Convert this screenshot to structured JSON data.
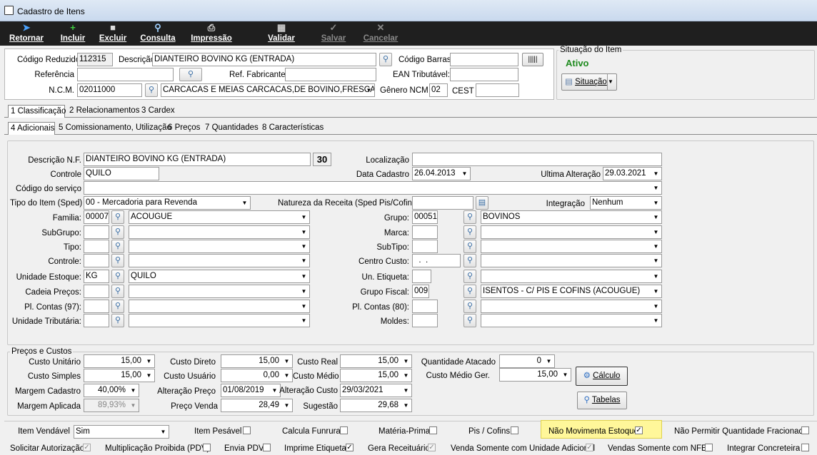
{
  "window": {
    "title": "Cadastro de Itens"
  },
  "toolbar": {
    "retornar": "Retornar",
    "incluir": "Incluir",
    "excluir": "Excluir",
    "consulta": "Consulta",
    "impressao": "Impressão",
    "validar": "Validar",
    "salvar": "Salvar",
    "cancelar": "Cancelar"
  },
  "header": {
    "codigo_reduzido_label": "Código Reduzido",
    "codigo_reduzido": "112315",
    "descricao_label": "Descrição",
    "descricao": "DIANTEIRO  BOVINO KG (ENTRADA)",
    "codigo_barras_label": "Código Barras",
    "codigo_barras": "",
    "referencia_label": "Referência",
    "referencia": "",
    "ref_fabricante_label": "Ref. Fabricante",
    "ref_fabricante": "",
    "ean_label": "EAN Tributável:",
    "ean": "",
    "ncm_label": "N.C.M.",
    "ncm": "02011000",
    "ncm_desc": "CARCACAS E MEIAS CARCACAS,DE BOVINO,FRESCAS",
    "genero_label": "Gênero NCM",
    "genero": "02",
    "cest_label": "CEST",
    "cest": ""
  },
  "situacao": {
    "title": "Situação do Item",
    "status": "Ativo",
    "button": "Situação"
  },
  "tabs_main": [
    "1 Classificação",
    "2 Relacionamentos",
    "3 Cardex"
  ],
  "tabs_sub": [
    "4 Adicionais",
    "5 Comissionamento, Utilização",
    "6 Preços",
    "7 Quantidades",
    "8 Características"
  ],
  "adicionais": {
    "descricao_nf_label": "Descrição N.F.",
    "descricao_nf": "DIANTEIRO  BOVINO KG (ENTRADA)",
    "descricao_nf_len": "30",
    "localizacao_label": "Localização",
    "controle_label": "Controle",
    "controle": "QUILO",
    "data_cadastro_label": "Data Cadastro",
    "data_cadastro": "26.04.2013",
    "ultima_alteracao_label": "Ultima Alteração",
    "ultima_alteracao": "29.03.2021",
    "codigo_servico_label": "Código do serviço",
    "tipo_item_label": "Tipo do Item (Sped)",
    "tipo_item": "00 - Mercadoria para Revenda",
    "natureza_label": "Natureza da Receita (Sped Pis/Cofins)",
    "integracao_label": "Integração",
    "integracao": "Nenhum",
    "familia_label": "Familia:",
    "familia_code": "00007",
    "familia_desc": "ACOUGUE",
    "grupo_label": "Grupo:",
    "grupo_code": "00051",
    "grupo_desc": "BOVINOS",
    "subgrupo_label": "SubGrupo:",
    "marca_label": "Marca:",
    "tipo_label": "Tipo:",
    "subtipo_label": "SubTipo:",
    "controle2_label": "Controle:",
    "centro_custo_label": "Centro Custo:",
    "centro_custo": "  .  .",
    "unidade_estoque_label": "Unidade Estoque:",
    "unidade_estoque_code": "KG",
    "unidade_estoque_desc": "QUILO",
    "un_etiqueta_label": "Un. Etiqueta:",
    "cadeia_label": "Cadeia Preços:",
    "grupo_fiscal_label": "Grupo Fiscal:",
    "grupo_fiscal_code": "009",
    "grupo_fiscal_desc": "ISENTOS - C/ PIS E COFINS (ACOUGUE)",
    "pl_contas97_label": "Pl. Contas (97):",
    "pl_contas80_label": "Pl. Contas (80):",
    "unidade_trib_label": "Unidade Tributária:",
    "moldes_label": "Moldes:"
  },
  "precos": {
    "title": "Preços e Custos",
    "custo_unitario_label": "Custo Unitário",
    "custo_unitario": "15,00",
    "custo_direto_label": "Custo Direto",
    "custo_direto": "15,00",
    "custo_real_label": "Custo Real",
    "custo_real": "15,00",
    "qtd_atacado_label": "Quantidade Atacado",
    "qtd_atacado": "0",
    "custo_simples_label": "Custo Simples",
    "custo_simples": "15,00",
    "custo_usuario_label": "Custo Usuário",
    "custo_usuario": "0,00",
    "custo_medio_label": "Custo Médio",
    "custo_medio": "15,00",
    "custo_medio_ger_label": "Custo Médio Ger.",
    "custo_medio_ger": "15,00",
    "margem_cadastro_label": "Margem Cadastro",
    "margem_cadastro": "40,00%",
    "alteracao_preco_label": "Alteração Preço",
    "alteracao_preco": "01/08/2019",
    "alteracao_custo_label": "Alteração Custo",
    "alteracao_custo": "29/03/2021",
    "margem_aplicada_label": "Margem Aplicada",
    "margem_aplicada": "89,93%",
    "preco_venda_label": "Preço Venda",
    "preco_venda": "28,49",
    "sugestao_label": "Sugestão",
    "sugestao": "29,68",
    "calculo_button": "Cálculo",
    "tabelas_button": "Tabelas"
  },
  "flags": {
    "item_vendavel_label": "Item Vendável",
    "item_vendavel": "Sim",
    "item_pesavel": "Item Pesável",
    "calcula_funrural": "Calcula Funrural",
    "materia_prima": "Matéria-Prima",
    "pis_cofins": "Pis / Cofins",
    "nao_movimenta": "Não Movimenta Estoque",
    "nao_permitir": "Não Permitir Quantidade Fracionada",
    "solicitar_autorizacao": "Solicitar Autorização",
    "multiplicacao": "Multiplicação Proibida (PDV)",
    "envia_pdv": "Envia PDV",
    "imprime_etiqueta": "Imprime Etiqueta",
    "gera_receituario": "Gera Receituário",
    "venda_somente_unidade": "Venda Somente com Unidade Adicional",
    "vendas_somente_nfe": "Vendas Somente com NFE.",
    "integrar_concreteira": "Integrar Concreteira",
    "highlight_color": "#fff79a"
  }
}
